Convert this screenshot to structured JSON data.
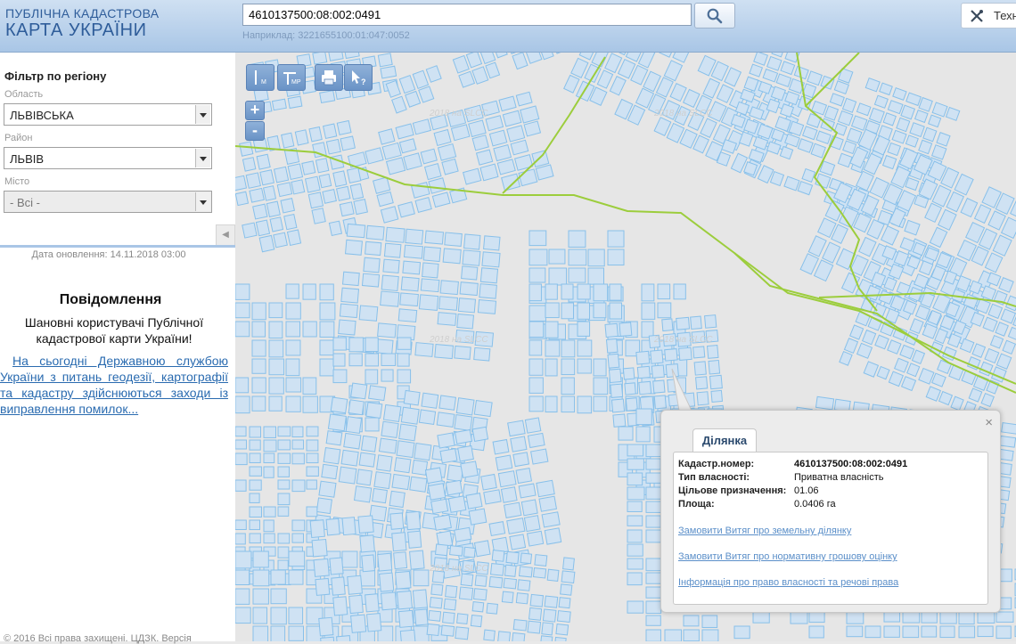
{
  "header": {
    "logo_line1": "ПУБЛІЧНА КАДАСТРОВА",
    "logo_line2": "КАРТА УКРАЇНИ",
    "search_value": "4610137500:08:002:0491",
    "search_hint": "Наприклад: 3221655100:01:047:0052",
    "tech_button_label": "Техн",
    "search_icon": "search-icon",
    "tools_icon": "tools-icon"
  },
  "sidebar": {
    "filter_title": "Фільтр по регіону",
    "oblast_label": "Область",
    "oblast_value": "ЛЬВІВСЬКА",
    "raion_label": "Район",
    "raion_value": "ЛЬВІВ",
    "misto_label": "Місто",
    "misto_value": "- Всі -",
    "update_date": "Дата оновлення: 14.11.2018 03:00",
    "notice_title": "Повідомлення",
    "notice_text": "Шановні користувачі Публічної кадастрової карти України!",
    "notice_link": "На сьогодні Державною службою України з питань геодезії, картографії та кадастру здійснюються заходи із виправлення помилок...",
    "copyright": "© 2016 Всі права захищені. ЦДЗК. Версія"
  },
  "map": {
    "tools": {
      "measure_distance": "М",
      "measure_area": "МР"
    },
    "watermark": "2018 на SLCC",
    "zoom_in": "+",
    "zoom_out": "-",
    "colors": {
      "parcel_fill": "#cfe2f3",
      "parcel_stroke": "#88c0ea",
      "boundary": "#9ccd3c",
      "background": "#e6e6e6"
    }
  },
  "popup": {
    "tab_label": "Ділянка",
    "close": "×",
    "fields": [
      {
        "key": "Кадастр.номер:",
        "value": "4610137500:08:002:0491"
      },
      {
        "key": "Тип власності:",
        "value": "Приватна власність"
      },
      {
        "key": "Цільове призначення:",
        "value": "01.06"
      },
      {
        "key": "Площа:",
        "value": "0.0406 га"
      }
    ],
    "links": [
      "Замовити Витяг про земельну ділянку",
      "Замовити Витяг про нормативну грошову оцінку",
      "Інформація про право власності та речові права"
    ]
  }
}
